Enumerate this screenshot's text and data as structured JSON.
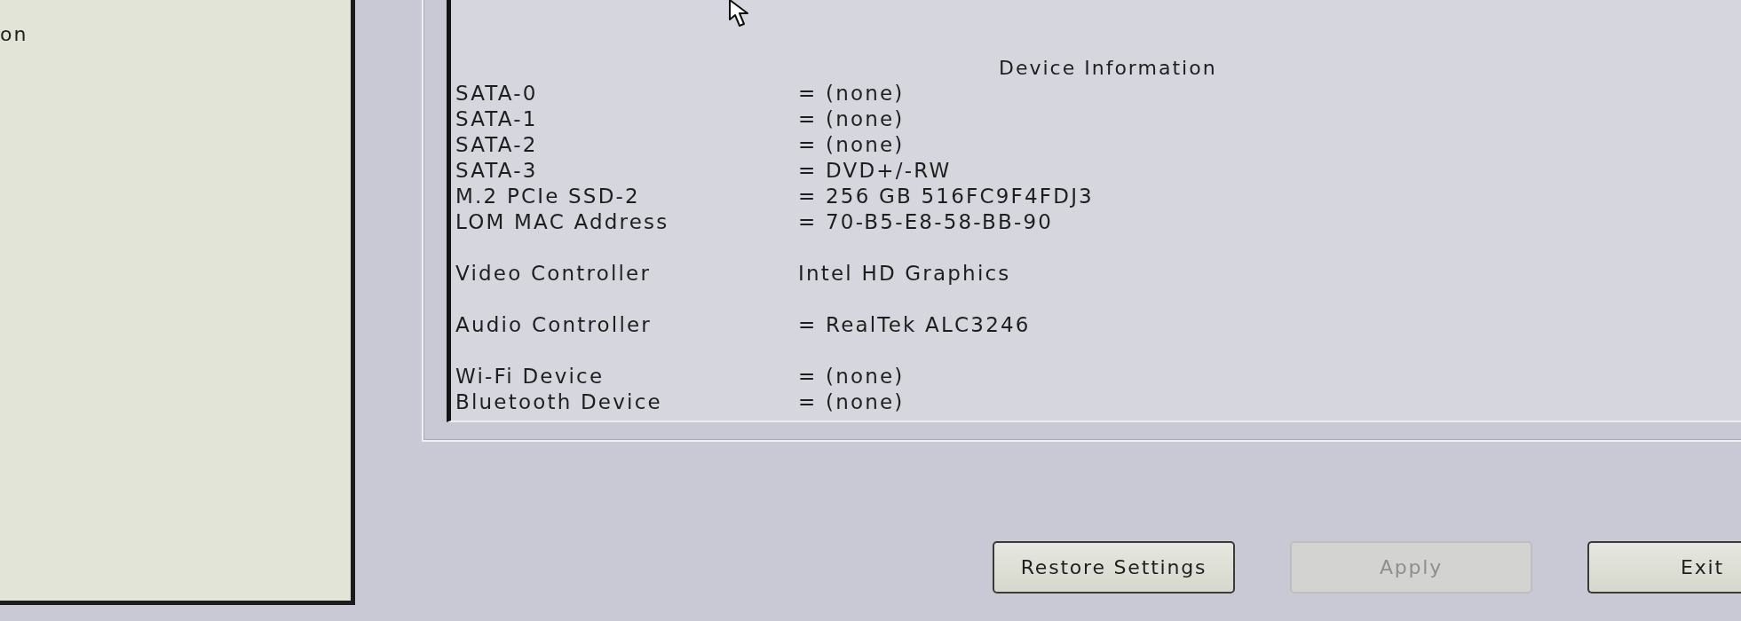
{
  "side_panel": {
    "text": "on"
  },
  "device_information": {
    "title": "Device Information",
    "groups": [
      {
        "rows": [
          {
            "label": "SATA-0",
            "value": "= (none)"
          },
          {
            "label": "SATA-1",
            "value": "= (none)"
          },
          {
            "label": "SATA-2",
            "value": "= (none)"
          },
          {
            "label": "SATA-3",
            "value": "= DVD+/-RW"
          },
          {
            "label": "M.2 PCIe SSD-2",
            "value": "= 256 GB 516FC9F4FDJ3"
          },
          {
            "label": "LOM MAC Address",
            "value": "= 70-B5-E8-58-BB-90"
          }
        ]
      },
      {
        "rows": [
          {
            "label": "Video Controller",
            "value": "Intel HD Graphics"
          }
        ]
      },
      {
        "rows": [
          {
            "label": "Audio Controller",
            "value": "= RealTek ALC3246"
          }
        ]
      },
      {
        "rows": [
          {
            "label": "Wi-Fi Device",
            "value": "= (none)"
          },
          {
            "label": "Bluetooth Device",
            "value": "= (none)"
          }
        ]
      }
    ]
  },
  "buttons": [
    {
      "label": "Restore Settings",
      "disabled": false
    },
    {
      "label": "Apply",
      "disabled": true
    },
    {
      "label": "Exit",
      "disabled": false
    }
  ]
}
